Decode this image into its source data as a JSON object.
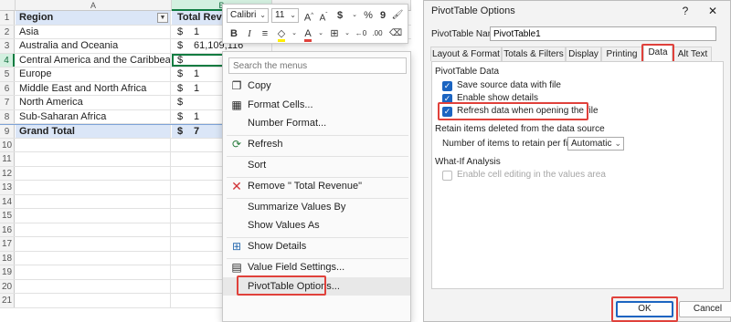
{
  "excel": {
    "columns": [
      {
        "letter": "A"
      },
      {
        "letter": "B"
      }
    ],
    "header_row": {
      "num": "1",
      "region": "Region",
      "revenue": "Total Revenue"
    },
    "rows": [
      {
        "num": "2",
        "region": "Asia",
        "cur": "$",
        "value": "1"
      },
      {
        "num": "3",
        "region": "Australia and Oceania",
        "cur": "$",
        "value": "61,109,116"
      },
      {
        "num": "4",
        "region": "Central America and the Caribbean",
        "cur": "$",
        "value": ""
      },
      {
        "num": "5",
        "region": "Europe",
        "cur": "$",
        "value": "1"
      },
      {
        "num": "6",
        "region": "Middle East and North Africa",
        "cur": "$",
        "value": "1"
      },
      {
        "num": "7",
        "region": "North America",
        "cur": "$",
        "value": ""
      },
      {
        "num": "8",
        "region": "Sub-Saharan Africa",
        "cur": "$",
        "value": "1"
      }
    ],
    "grand_total": {
      "num": "9",
      "label": "Grand Total",
      "cur": "$",
      "value": "7"
    },
    "empty_rows": [
      "10",
      "11",
      "12",
      "13",
      "14",
      "15",
      "16",
      "17",
      "18",
      "19",
      "20",
      "21"
    ]
  },
  "mini_toolbar": {
    "font_name": "Calibri",
    "font_size": "11",
    "bold": "B",
    "italic": "I"
  },
  "context_menu": {
    "search_placeholder": "Search the menus",
    "items": {
      "copy": "Copy",
      "format_cells": "Format Cells...",
      "number_format": "Number Format...",
      "refresh": "Refresh",
      "sort": "Sort",
      "remove": "Remove \" Total Revenue\"",
      "summarize": "Summarize Values By",
      "show_values": "Show Values As",
      "show_details": "Show Details",
      "field_settings": "Value Field Settings...",
      "pivot_options": "PivotTable Options..."
    }
  },
  "dialog": {
    "title": "PivotTable Options",
    "help": "?",
    "close": "✕",
    "name_label": "PivotTable Name:",
    "name_value": "PivotTable1",
    "tabs": [
      "Layout & Format",
      "Totals & Filters",
      "Display",
      "Printing",
      "Data",
      "Alt Text"
    ],
    "active_tab": "Data",
    "group_pivot_data": "PivotTable Data",
    "save_source": "Save source data with file",
    "enable_details": "Enable show details",
    "refresh_on_open": "Refresh data when opening the file",
    "group_retain": "Retain items deleted from the data source",
    "retain_label": "Number of items to retain per field:",
    "retain_value": "Automatic",
    "group_whatif": "What-If Analysis",
    "enable_edit": "Enable cell editing in the values area",
    "ok": "OK",
    "cancel": "Cancel"
  },
  "colors": {
    "accent": "#107c41",
    "highlight": "#e0413b",
    "checkbox": "#1b64c1",
    "pivot_header": "#dbe6f7"
  }
}
